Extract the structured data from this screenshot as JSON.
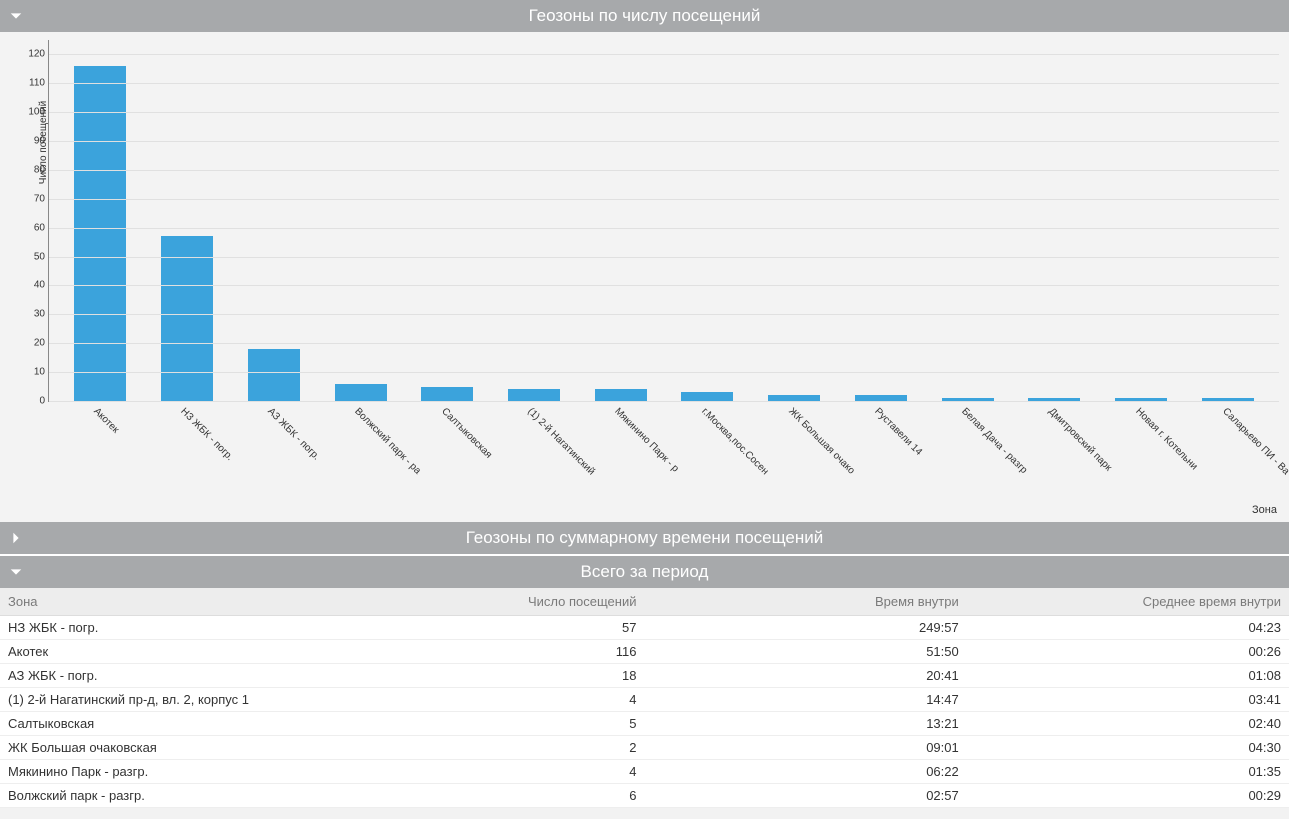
{
  "sections": {
    "chart_title": "Геозоны по числу посещений",
    "collapsed_title": "Геозоны по суммарному времени посещений",
    "totals_title": "Всего за период"
  },
  "chart_data": {
    "type": "bar",
    "ylabel": "Число посещений",
    "xlabel": "Зона",
    "ylim": [
      0,
      125
    ],
    "yticks": [
      0,
      10,
      20,
      30,
      40,
      50,
      60,
      70,
      80,
      90,
      100,
      110,
      120
    ],
    "categories": [
      "Акотек",
      "НЗ ЖБК - погр.",
      "АЗ ЖБК - погр.",
      "Волжский парк - ра",
      "Салтыковская",
      "(1) 2-й Нагатинский",
      "Мякинино Парк - р",
      "г.Москва,пос.Сосен",
      "ЖК Большая очако",
      "Руставели 14",
      "Белая Дача - разгр",
      "Дмитровский парк",
      "Новая г. Котельни",
      "Саларьево ПИ - Ва"
    ],
    "values": [
      116,
      57,
      18,
      6,
      5,
      4,
      4,
      3,
      2,
      2,
      1,
      1,
      1,
      1
    ]
  },
  "table": {
    "headers": [
      "Зона",
      "Число посещений",
      "Время внутри",
      "Среднее время внутри"
    ],
    "rows": [
      {
        "zone": "НЗ ЖБК - погр.",
        "visits": "57",
        "time": "249:57",
        "avg": "04:23"
      },
      {
        "zone": "Акотек",
        "visits": "116",
        "time": "51:50",
        "avg": "00:26"
      },
      {
        "zone": "АЗ ЖБК - погр.",
        "visits": "18",
        "time": "20:41",
        "avg": "01:08"
      },
      {
        "zone": "(1) 2-й Нагатинский пр-д, вл. 2, корпус 1",
        "visits": "4",
        "time": "14:47",
        "avg": "03:41"
      },
      {
        "zone": "Салтыковская",
        "visits": "5",
        "time": "13:21",
        "avg": "02:40"
      },
      {
        "zone": "ЖК Большая очаковская",
        "visits": "2",
        "time": "09:01",
        "avg": "04:30"
      },
      {
        "zone": "Мякинино Парк - разгр.",
        "visits": "4",
        "time": "06:22",
        "avg": "01:35"
      },
      {
        "zone": "Волжский парк - разгр.",
        "visits": "6",
        "time": "02:57",
        "avg": "00:29"
      }
    ]
  }
}
